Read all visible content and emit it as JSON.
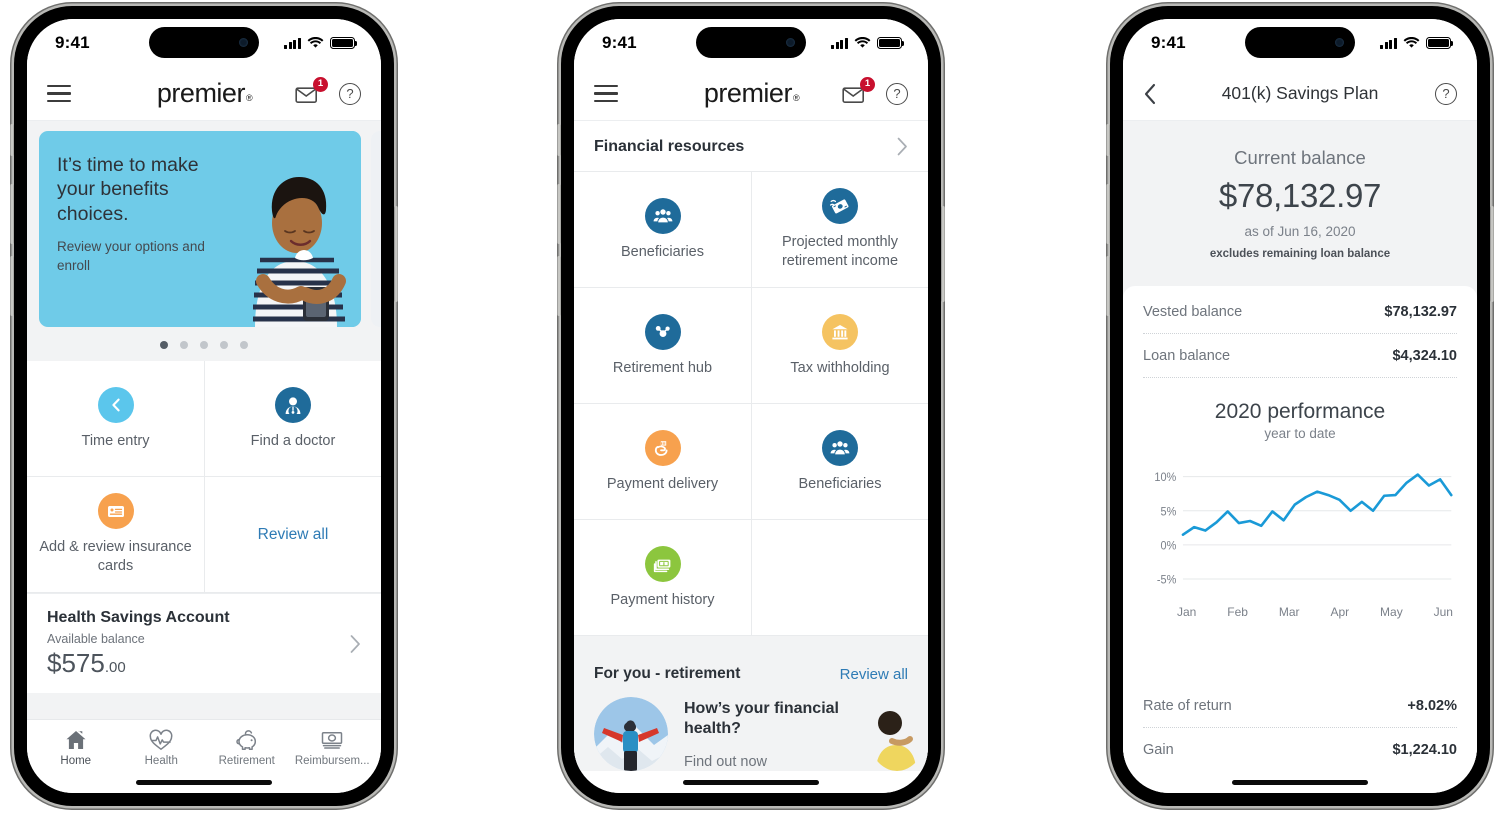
{
  "statusbar": {
    "time": "9:41"
  },
  "brand": {
    "name": "premier",
    "mark": "®"
  },
  "phone1": {
    "header": {
      "messages_badge": "1",
      "help": "?"
    },
    "hero": {
      "headline": "It’s time to make your benefits choices.",
      "subtext": "Review your options and enroll",
      "dots_total": 5,
      "active_dot": 1
    },
    "tiles": [
      {
        "label": "Time entry",
        "icon": "clock-icon",
        "color": "#5bc6ec"
      },
      {
        "label": "Find a doctor",
        "icon": "doctor-person-icon",
        "color": "#1f6b9a"
      },
      {
        "label": "Add & review insurance cards",
        "icon": "insurance-card-icon",
        "color": "#f7a14e"
      },
      {
        "label": "Review all",
        "icon": "",
        "color": ""
      }
    ],
    "hsa": {
      "title": "Health Savings Account",
      "subtitle": "Available balance",
      "amount_main": "$575",
      "amount_cents": ".00"
    },
    "tabs": [
      {
        "label": "Home",
        "icon": "home-icon"
      },
      {
        "label": "Health",
        "icon": "heart-pulse-icon"
      },
      {
        "label": "Retirement",
        "icon": "piggy-bank-icon"
      },
      {
        "label": "Reimbursem...",
        "icon": "money-bill-icon"
      }
    ]
  },
  "phone2": {
    "header": {
      "messages_badge": "1",
      "help": "?"
    },
    "section": {
      "title": "Financial resources"
    },
    "tiles": [
      {
        "label": "Beneficiaries",
        "icon": "people-group-icon",
        "color": "#1f6b9a"
      },
      {
        "label": "Projected monthly retirement income",
        "icon": "money-fly-icon",
        "color": "#1f6b9a"
      },
      {
        "label": "Retirement hub",
        "icon": "hub-nodes-icon",
        "color": "#1f6b9a"
      },
      {
        "label": "Tax withholding",
        "icon": "bank-building-icon",
        "color": "#f5c361"
      },
      {
        "label": "Payment delivery",
        "icon": "hand-money-icon",
        "color": "#f7a14e"
      },
      {
        "label": "Beneficiaries",
        "icon": "people-group-icon",
        "color": "#1f6b9a"
      },
      {
        "label": "Payment history",
        "icon": "cash-stack-icon",
        "color": "#8cc63e"
      }
    ],
    "foryou": {
      "title": "For you - retirement",
      "link": "Review all",
      "card_title": "How’s your financial health?",
      "card_cta": "Find out now"
    }
  },
  "phone3": {
    "header": {
      "title": "401(k) Savings Plan",
      "help": "?",
      "back": "back-icon"
    },
    "balance": {
      "label": "Current balance",
      "amount": "$78,132.97",
      "as_of": "as of Jun 16, 2020",
      "note": "excludes remaining loan balance"
    },
    "rows_top": [
      {
        "key": "Vested balance",
        "value": "$78,132.97"
      },
      {
        "key": "Loan balance",
        "value": "$4,324.10"
      }
    ],
    "rows_bottom": [
      {
        "key": "Rate of return",
        "value": "+8.02%"
      },
      {
        "key": "Gain",
        "value": "$1,224.10"
      }
    ],
    "chart_data": {
      "type": "line",
      "title": "2020 performance",
      "subtitle": "year to date",
      "xlabel": "",
      "ylabel": "",
      "ylim": [
        -5,
        12
      ],
      "yticks": [
        "10%",
        "5%",
        "0%",
        "-5%"
      ],
      "ytick_values": [
        10,
        5,
        0,
        -5
      ],
      "grid": true,
      "legend": "none",
      "line_color": "#1a9ad7",
      "categories": [
        "Jan",
        "Feb",
        "Mar",
        "Apr",
        "May",
        "Jun"
      ],
      "x": [
        0,
        1,
        2,
        3,
        4,
        5,
        6,
        7,
        8,
        9,
        10,
        11,
        12,
        13,
        14,
        15,
        16,
        17,
        18,
        19,
        20,
        21,
        22,
        23,
        24,
        25,
        26
      ],
      "values": [
        1.5,
        2.6,
        2.1,
        3.3,
        4.9,
        3.2,
        3.5,
        2.8,
        4.9,
        3.6,
        5.9,
        7.0,
        7.8,
        7.3,
        6.6,
        5.0,
        6.3,
        5.0,
        7.2,
        7.3,
        9.1,
        10.3,
        8.7,
        9.6,
        7.3
      ]
    }
  }
}
